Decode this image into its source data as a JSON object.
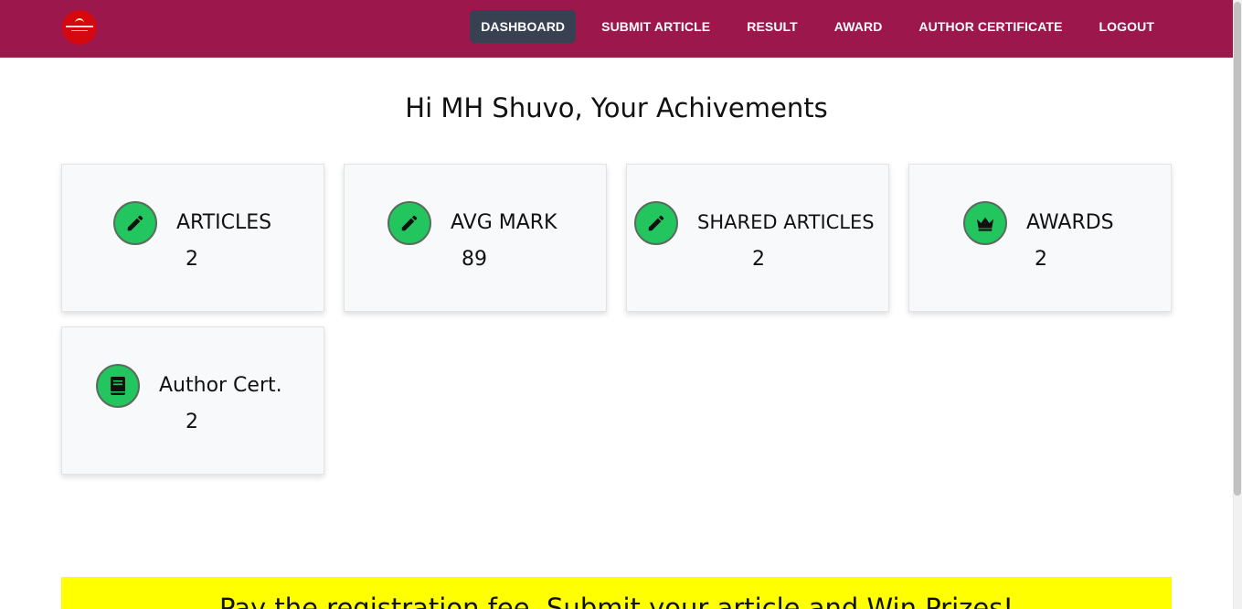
{
  "colors": {
    "brand": "#9c174b",
    "active_nav": "#374151",
    "icon_green": "#22c55e",
    "banner": "#ffff00"
  },
  "logo": {
    "icon": "site-logo"
  },
  "nav": {
    "items": [
      {
        "label": "DASHBOARD",
        "active": true
      },
      {
        "label": "SUBMIT ARTICLE"
      },
      {
        "label": "RESULT"
      },
      {
        "label": "AWARD"
      },
      {
        "label": "AUTHOR CERTIFICATE"
      },
      {
        "label": "LOGOUT"
      }
    ]
  },
  "greeting": "Hi MH Shuvo, Your Achivements",
  "cards": [
    {
      "label": "ARTICLES",
      "value": "2",
      "icon": "pencil-icon"
    },
    {
      "label": "AVG MARK",
      "value": "89",
      "icon": "pencil-icon"
    },
    {
      "label": "SHARED ARTICLES",
      "value": "2",
      "icon": "pencil-icon"
    },
    {
      "label": "AWARDS",
      "value": "2",
      "icon": "crown-icon"
    },
    {
      "label": "Author Cert.",
      "value": "2",
      "icon": "book-icon"
    }
  ],
  "banner": {
    "text": "Pay the registration fee, Submit your article and Win Prizes!"
  }
}
